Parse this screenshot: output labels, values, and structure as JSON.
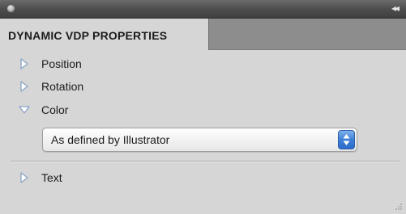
{
  "panel": {
    "tab_label": "DYNAMIC VDP PROPERTIES",
    "collapse_glyph": "◂◂"
  },
  "properties": [
    {
      "label": "Position",
      "expanded": false,
      "icon": "disclosure-triangle-right-icon"
    },
    {
      "label": "Rotation",
      "expanded": false,
      "icon": "disclosure-triangle-right-icon"
    },
    {
      "label": "Color",
      "expanded": true,
      "icon": "disclosure-triangle-down-icon"
    },
    {
      "label": "Text",
      "expanded": false,
      "icon": "disclosure-triangle-right-icon"
    }
  ],
  "color_select": {
    "selected": "As defined by Illustrator",
    "icon": "up-down-arrows-icon"
  },
  "colors": {
    "accent": "#3e7fd8",
    "panel_bg": "#d6d6d6",
    "titlebar": "#4e4e4e",
    "tab_strip": "#8d8d8d",
    "disclosure": "#9ab1cf"
  }
}
